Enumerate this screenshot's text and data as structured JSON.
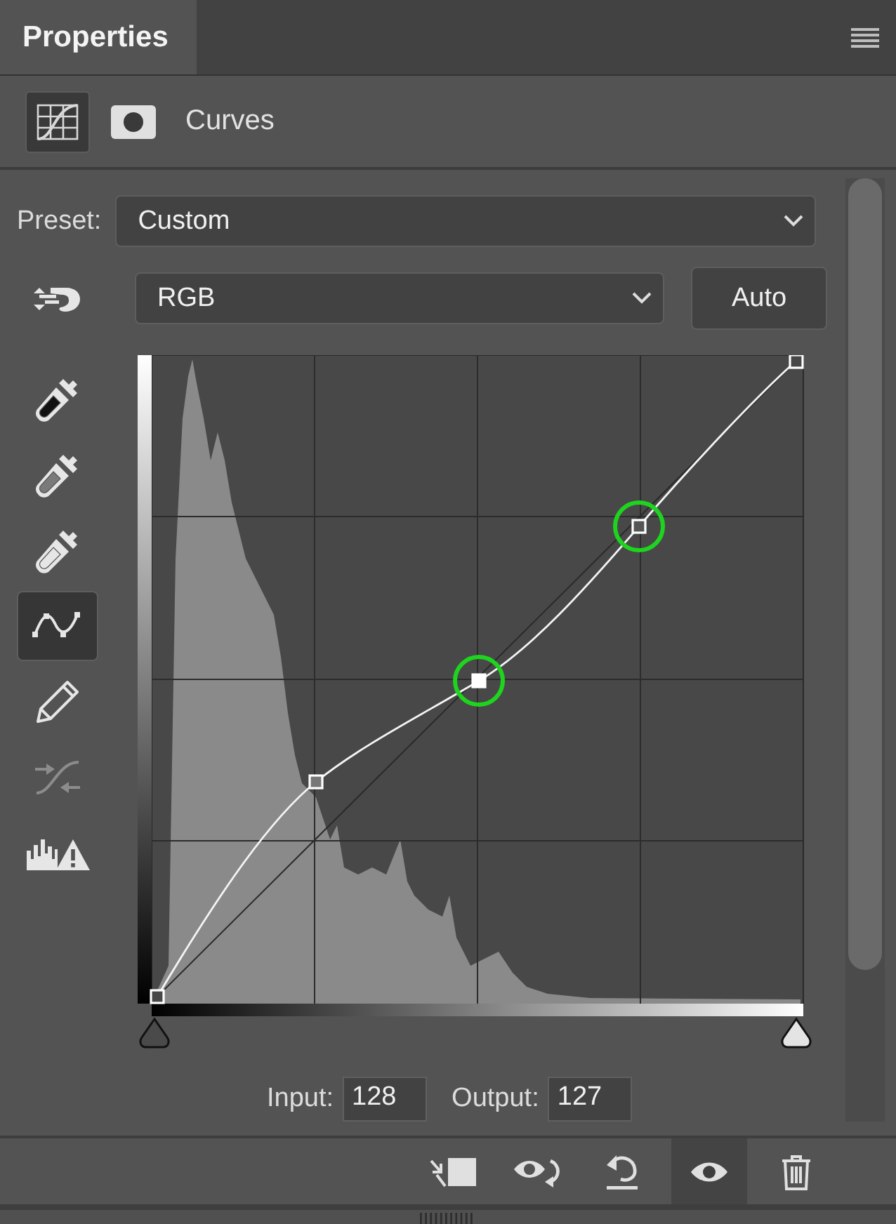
{
  "panel_tab": {
    "label": "Properties",
    "selected": true
  },
  "adjustment_icons": [
    {
      "kind": "curves",
      "selected": true
    },
    {
      "kind": "mask",
      "selected": false
    }
  ],
  "adjustment_title": "Curves",
  "preset": {
    "label": "Preset:",
    "value": "Custom"
  },
  "channel": {
    "value": "RGB"
  },
  "auto_button": "Auto",
  "tools": [
    {
      "kind": "black-eyedropper",
      "selected": false
    },
    {
      "kind": "gray-eyedropper",
      "selected": false
    },
    {
      "kind": "white-eyedropper",
      "selected": false
    },
    {
      "kind": "points",
      "selected": true
    },
    {
      "kind": "pencil",
      "selected": false
    },
    {
      "kind": "smooth",
      "selected": false
    },
    {
      "kind": "clipping",
      "selected": false
    }
  ],
  "input": {
    "label": "Input:",
    "value": "128"
  },
  "output": {
    "label": "Output:",
    "value": "127"
  },
  "footer_buttons": [
    {
      "kind": "clip",
      "selected": false
    },
    {
      "kind": "view-previous",
      "selected": false
    },
    {
      "kind": "reset",
      "selected": false
    },
    {
      "kind": "visibility",
      "selected": true
    },
    {
      "kind": "delete",
      "selected": false
    }
  ]
}
